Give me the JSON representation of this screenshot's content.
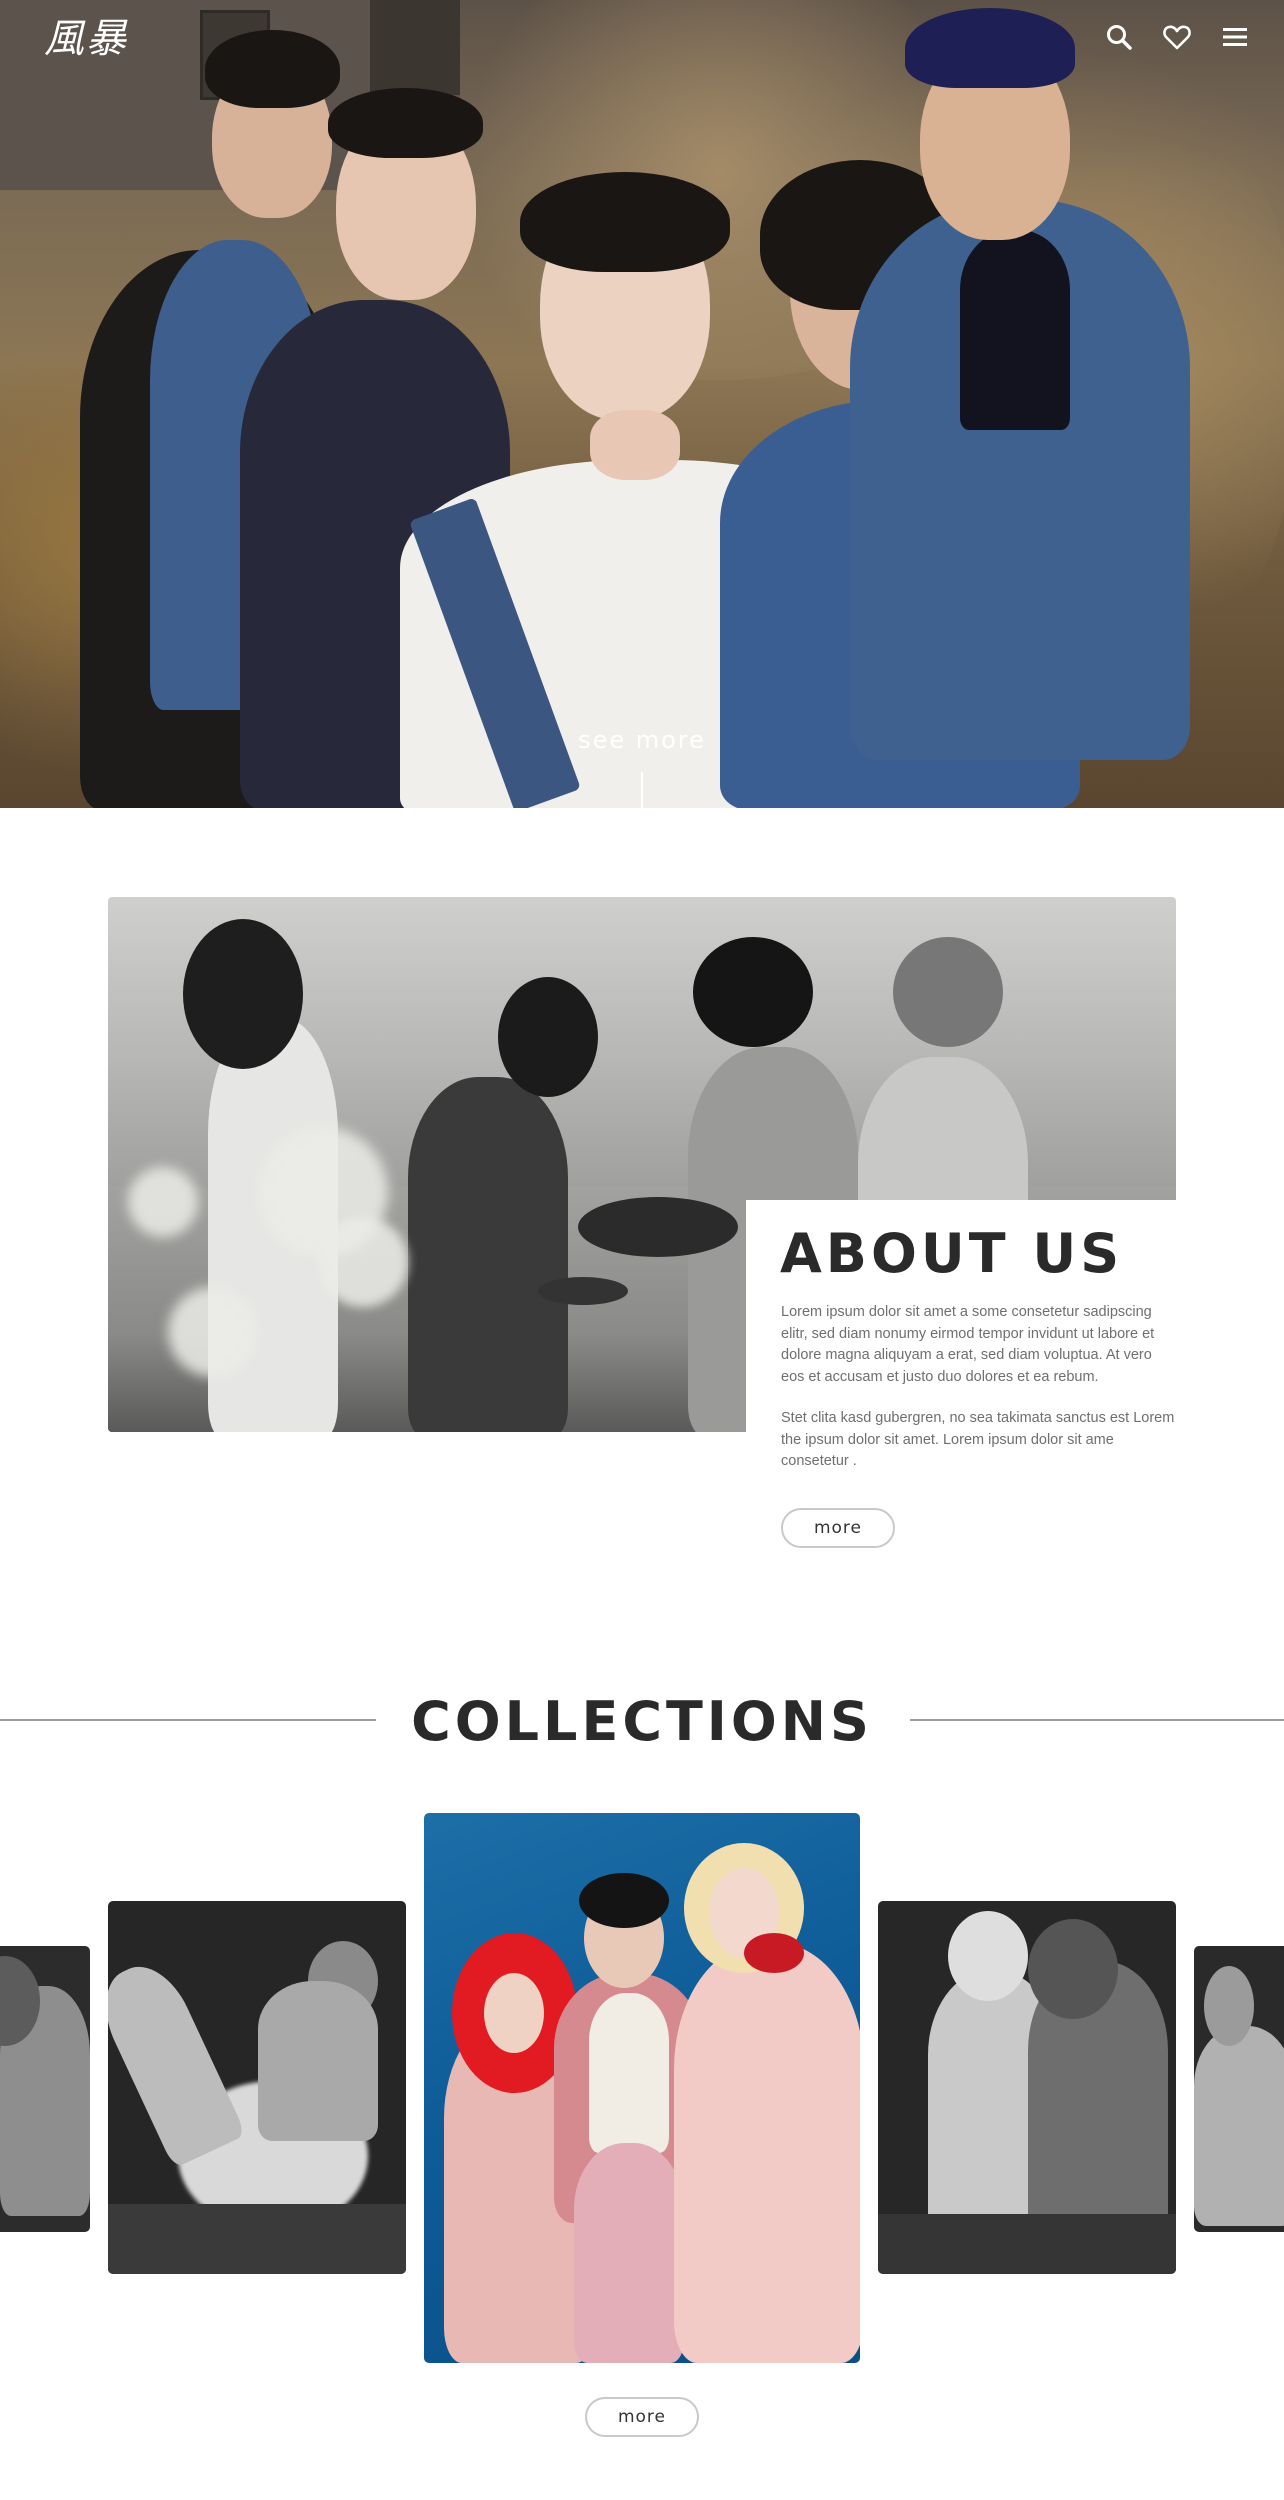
{
  "header": {
    "logo_text": "風暴",
    "icons": [
      "search-icon",
      "heart-icon",
      "menu-icon"
    ]
  },
  "hero": {
    "see_more_label": "see more"
  },
  "about": {
    "title": "ABOUT US",
    "paragraph1": "Lorem ipsum dolor sit amet a some consetetur sadipscing elitr, sed diam nonumy eirmod tempor invidunt ut labore et dolore magna aliquyam a erat, sed diam voluptua. At vero eos et accusam et justo duo dolores et ea rebum.",
    "paragraph2": "Stet clita kasd gubergren, no sea takimata sanctus est Lorem the ipsum dolor sit amet. Lorem ipsum dolor sit ame consetetur .",
    "more_label": "more"
  },
  "collections": {
    "title": "COLLECTIONS",
    "more_label": "more"
  },
  "colors": {
    "text_dark": "#2a2a2a",
    "text_body": "#6f6f6f",
    "divider": "#9e9e9e",
    "button_border": "#c9c9c9",
    "accent_blue": "#0f5d99"
  }
}
